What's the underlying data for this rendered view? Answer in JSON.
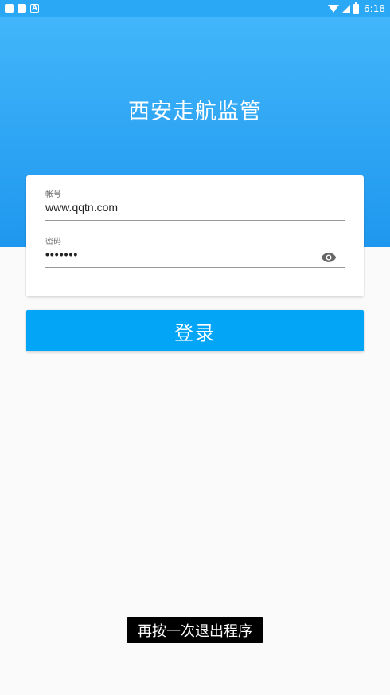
{
  "status_bar": {
    "time": "6:18",
    "notification_icons": [
      "app-icon",
      "app-icon",
      "a-icon"
    ]
  },
  "header": {
    "title": "西安走航监管"
  },
  "form": {
    "account_label": "帐号",
    "account_value": "www.qqtn.com",
    "password_label": "密码",
    "password_value": "•••••••"
  },
  "login_button": {
    "label": "登录"
  },
  "toast": {
    "text": "再按一次退出程序"
  },
  "colors": {
    "header_gradient_top": "#45b8fb",
    "header_gradient_bottom": "#1e97ee",
    "button": "#03a6f7",
    "background": "#fafafa"
  }
}
